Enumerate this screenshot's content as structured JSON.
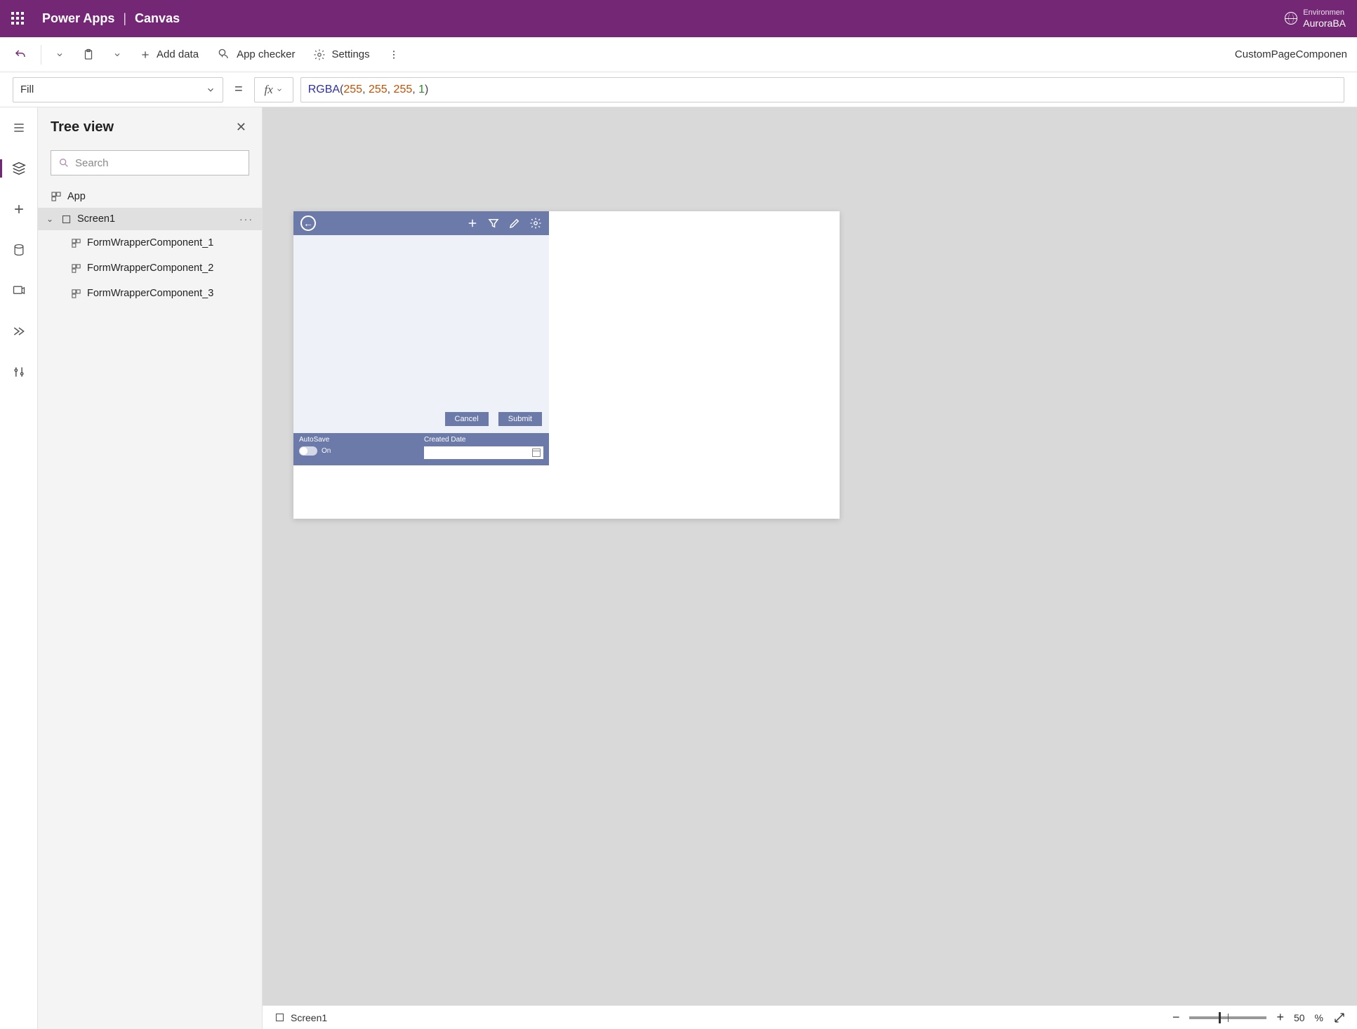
{
  "header": {
    "app_name": "Power Apps",
    "mode": "Canvas",
    "env_label": "Environmen",
    "env_name": "AuroraBA"
  },
  "command_bar": {
    "add_data": "Add data",
    "app_checker": "App checker",
    "settings": "Settings",
    "right_label": "CustomPageComponen"
  },
  "formula": {
    "property": "Fill",
    "fn": "RGBA",
    "args": [
      "255",
      "255",
      "255",
      "1"
    ]
  },
  "tree": {
    "title": "Tree view",
    "search_placeholder": "Search",
    "app_label": "App",
    "screen_label": "Screen1",
    "children": [
      "FormWrapperComponent_1",
      "FormWrapperComponent_2",
      "FormWrapperComponent_3"
    ]
  },
  "preview": {
    "cancel": "Cancel",
    "submit": "Submit",
    "autosave_label": "AutoSave",
    "autosave_value": "On",
    "created_label": "Created Date"
  },
  "status": {
    "screen": "Screen1",
    "zoom_value": "50",
    "zoom_unit": "%"
  }
}
